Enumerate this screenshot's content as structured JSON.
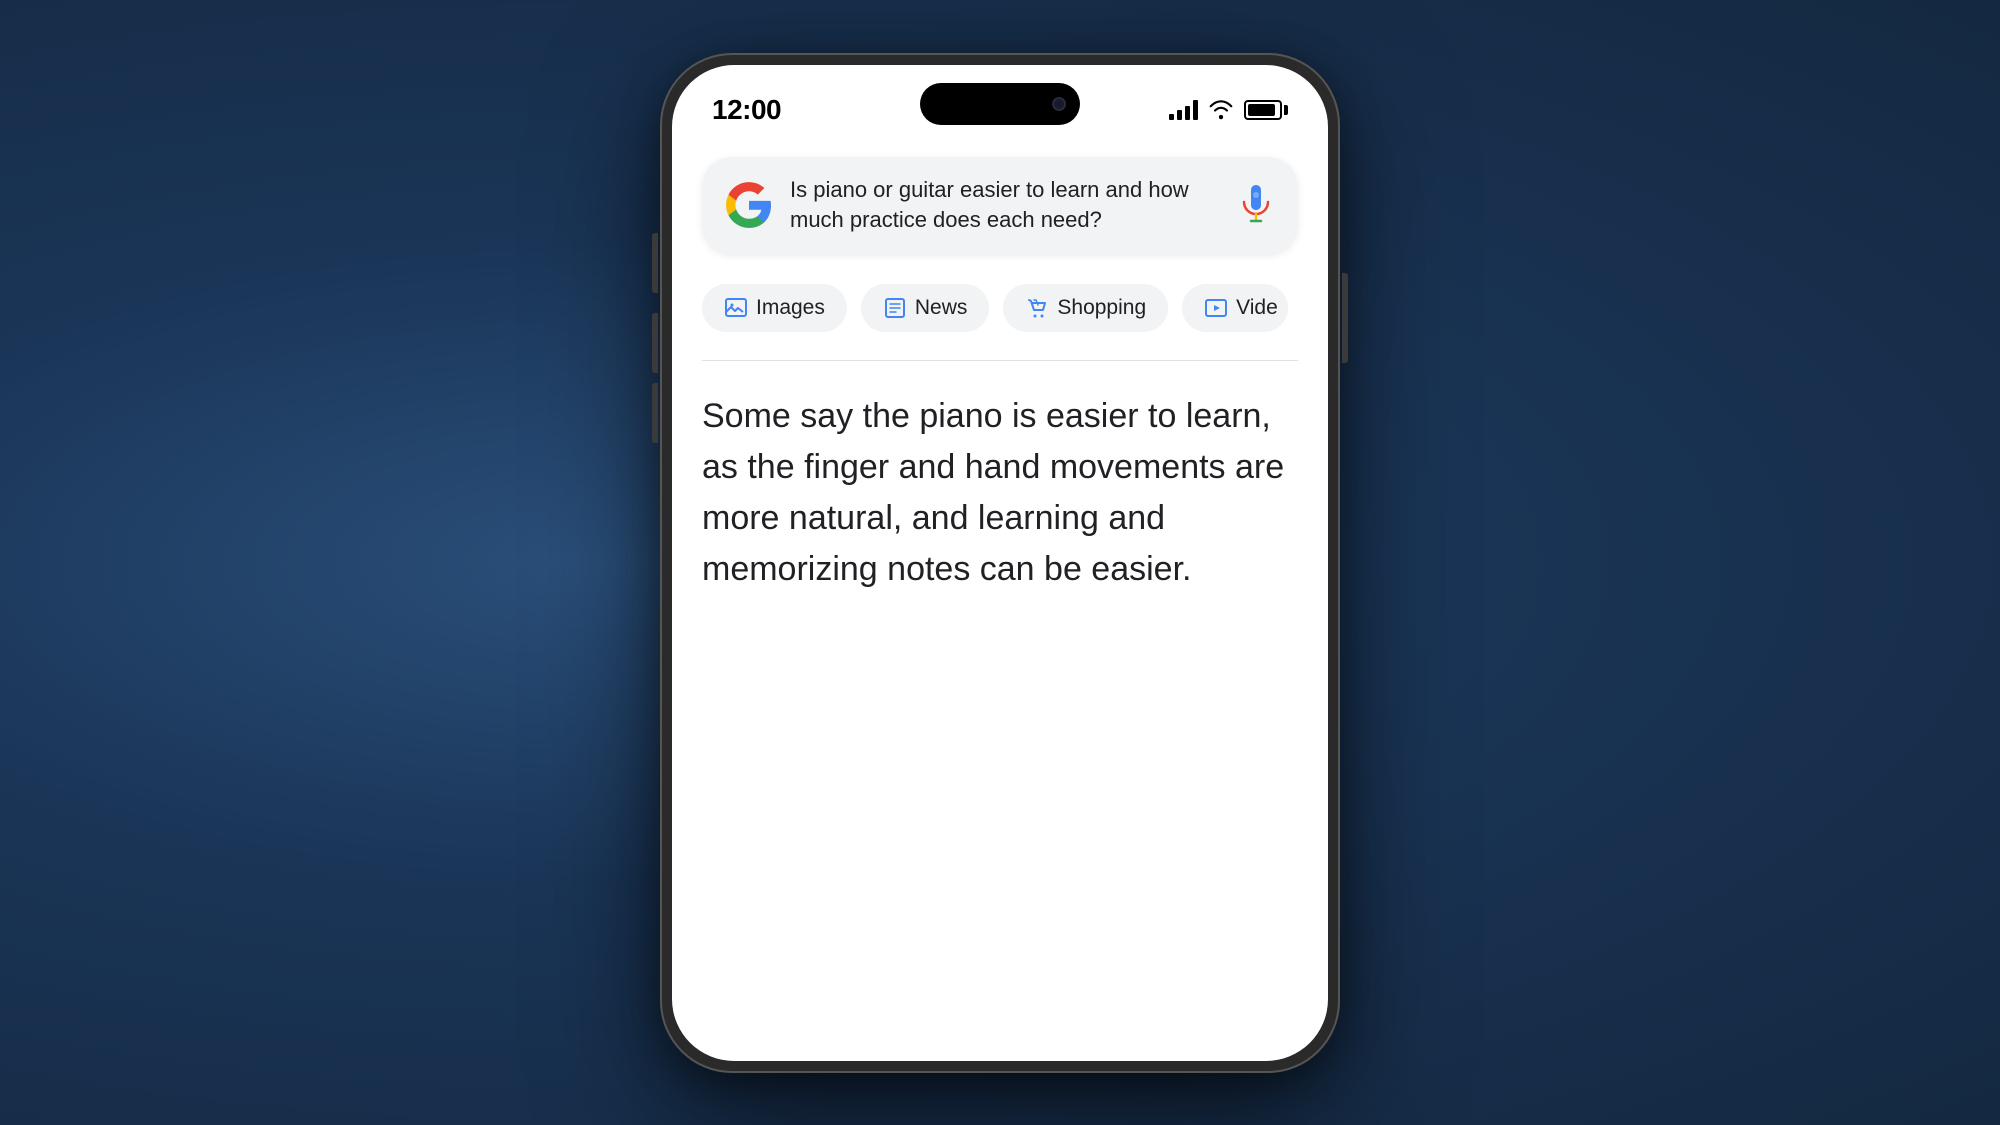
{
  "background": {
    "color": "#1a3557"
  },
  "phone": {
    "status_bar": {
      "time": "12:00",
      "signal_bars": 4,
      "wifi": true,
      "battery_percent": 90
    },
    "search_bar": {
      "query": "Is piano or guitar easier to learn and how much practice does each need?",
      "logo_alt": "Google"
    },
    "filter_tabs": [
      {
        "id": "images",
        "label": "Images",
        "icon": "images-icon"
      },
      {
        "id": "news",
        "label": "News",
        "icon": "news-icon"
      },
      {
        "id": "shopping",
        "label": "Shopping",
        "icon": "shopping-icon"
      },
      {
        "id": "videos",
        "label": "Vide",
        "icon": "videos-icon"
      }
    ],
    "ai_answer": "Some say the piano is easier to learn, as the finger and hand movements are more natural, and learning and memorizing notes can be easier."
  }
}
